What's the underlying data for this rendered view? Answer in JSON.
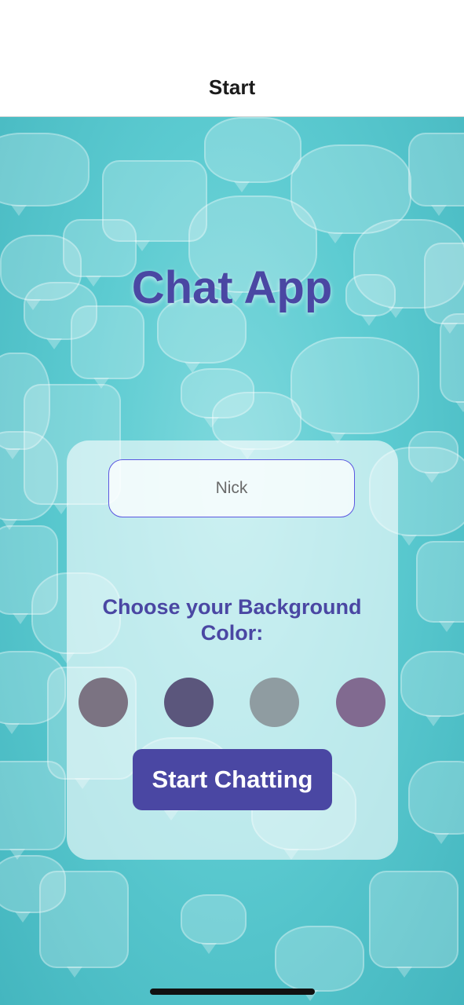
{
  "nav": {
    "title": "Start"
  },
  "main": {
    "app_title": "Chat App",
    "name_input": {
      "value": "",
      "placeholder": "Nick"
    },
    "choose_label": "Choose your Background Color:",
    "color_options": [
      {
        "color": "#7b7382"
      },
      {
        "color": "#5b567c"
      },
      {
        "color": "#8f9ca1"
      },
      {
        "color": "#816a90"
      }
    ],
    "start_button_label": "Start Chatting"
  },
  "colors": {
    "accent": "#4a47a3",
    "background": "#5ccbd1",
    "input_border": "#5b57e0"
  }
}
